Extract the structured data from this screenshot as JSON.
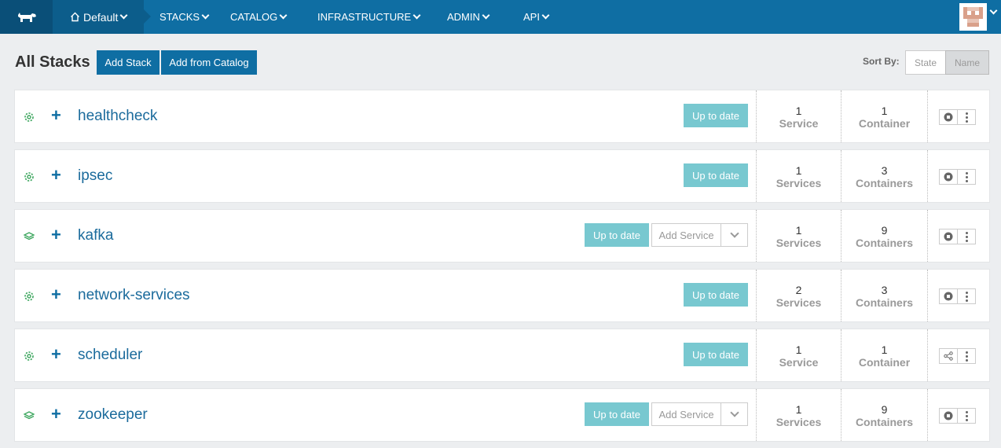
{
  "nav": {
    "environment": "Default",
    "items": [
      "STACKS",
      "CATALOG",
      "INFRASTRUCTURE",
      "ADMIN",
      "API"
    ]
  },
  "header": {
    "title": "All Stacks",
    "add_stack": "Add Stack",
    "add_from_catalog": "Add from Catalog",
    "sort_by_label": "Sort By:",
    "sort_state": "State",
    "sort_name": "Name"
  },
  "stacks": [
    {
      "name": "healthcheck",
      "icon": "gear-icon",
      "status": "Up to date",
      "services_num": "1",
      "services_unit": "Service",
      "containers_num": "1",
      "containers_unit": "Container",
      "action_icon": "stop-icon"
    },
    {
      "name": "ipsec",
      "icon": "gear-icon",
      "status": "Up to date",
      "services_num": "1",
      "services_unit": "Services",
      "containers_num": "3",
      "containers_unit": "Containers",
      "action_icon": "stop-icon"
    },
    {
      "name": "kafka",
      "icon": "layers-icon",
      "status": "Up to date",
      "add_service": "Add Service",
      "services_num": "1",
      "services_unit": "Services",
      "containers_num": "9",
      "containers_unit": "Containers",
      "action_icon": "stop-icon"
    },
    {
      "name": "network-services",
      "icon": "gear-icon",
      "status": "Up to date",
      "services_num": "2",
      "services_unit": "Services",
      "containers_num": "3",
      "containers_unit": "Containers",
      "action_icon": "stop-icon"
    },
    {
      "name": "scheduler",
      "icon": "gear-icon",
      "status": "Up to date",
      "services_num": "1",
      "services_unit": "Service",
      "containers_num": "1",
      "containers_unit": "Container",
      "action_icon": "share-icon"
    },
    {
      "name": "zookeeper",
      "icon": "layers-icon",
      "status": "Up to date",
      "add_service": "Add Service",
      "services_num": "1",
      "services_unit": "Services",
      "containers_num": "9",
      "containers_unit": "Containers",
      "action_icon": "stop-icon"
    }
  ],
  "colors": {
    "nav_bg": "#0f6ea3",
    "accent": "#0f6ea3",
    "status_badge": "#78c8d0",
    "healthy_icon": "#3aa55c"
  }
}
